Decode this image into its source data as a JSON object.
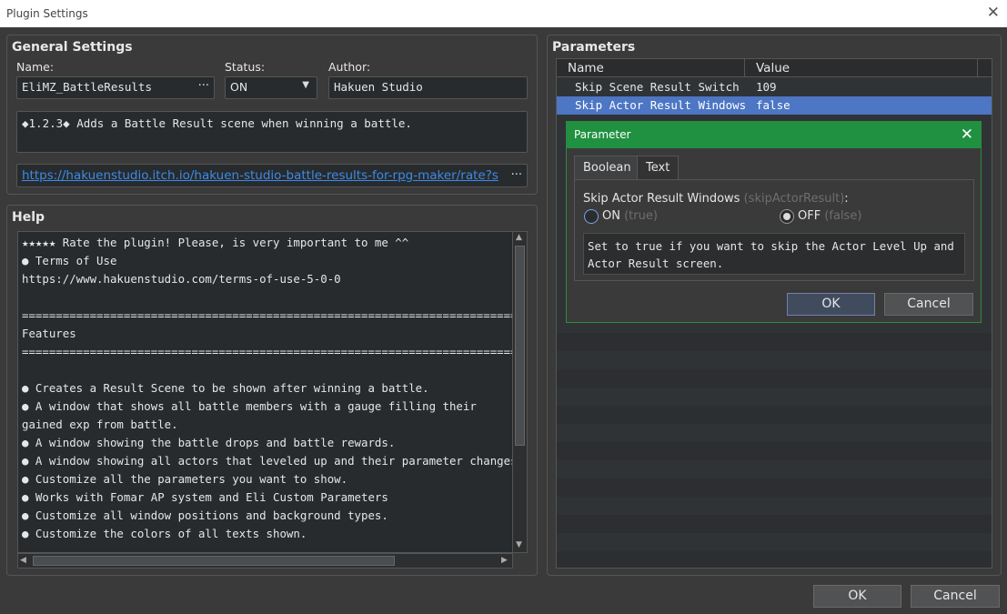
{
  "window": {
    "title": "Plugin Settings",
    "close_glyph": "✕"
  },
  "general": {
    "title": "General Settings",
    "name_label": "Name:",
    "name_value": "EliMZ_BattleResults",
    "name_button": "···",
    "status_label": "Status:",
    "status_value": "ON",
    "status_arrow": "▼",
    "author_label": "Author:",
    "author_value": "Hakuen Studio",
    "description": "◆1.2.3◆ Adds a Battle Result scene when winning a battle.",
    "url": "https://hakuenstudio.itch.io/hakuen-studio-battle-results-for-rpg-maker/rate?s",
    "url_ellipsis": "···"
  },
  "help": {
    "title": "Help",
    "lines": [
      "★★★★★ Rate the plugin! Please, is very important to me ^^",
      "● Terms of Use",
      "https://www.hakuenstudio.com/terms-of-use-5-0-0",
      "",
      "============================================================================",
      "Features",
      "============================================================================",
      "",
      "● Creates a Result Scene to be shown after winning a battle.",
      "● A window that shows all battle members with a gauge filling their",
      "gained exp from battle.",
      "● A window showing the battle drops and battle rewards.",
      "● A window showing all actors that leveled up and their parameter changes.",
      "● Customize all the parameters you want to show.",
      "● Works with Fomar AP system and Eli Custom Parameters",
      "● Customize all window positions and background types.",
      "● Customize the colors of all texts shown."
    ],
    "scroll_up": "▲",
    "scroll_down": "▼",
    "scroll_left": "◀",
    "scroll_right": "▶"
  },
  "parameters": {
    "title": "Parameters",
    "col_name": "Name",
    "col_value": "Value",
    "rows": [
      {
        "name": "Skip Scene Result Switch",
        "value": "109"
      },
      {
        "name": "Skip Actor Result Windows",
        "value": "false"
      }
    ]
  },
  "dialog": {
    "title": "Parameter",
    "close_glyph": "✕",
    "tabs": [
      "Boolean",
      "Text"
    ],
    "param_label": "Skip Actor Result Windows",
    "param_key": "(skipActorResult)",
    "param_colon": ":",
    "on_label": "ON",
    "on_hint": "(true)",
    "off_label": "OFF",
    "off_hint": "(false)",
    "description_line1": "Set to true if you want to skip the Actor Level Up and",
    "description_line2": "Actor Result screen.",
    "ok": "OK",
    "cancel": "Cancel"
  },
  "footer": {
    "ok": "OK",
    "cancel": "Cancel"
  },
  "colors": {
    "accent_green": "#1f9140",
    "selection_blue": "#4d76c4",
    "link": "#3d8ae8"
  }
}
